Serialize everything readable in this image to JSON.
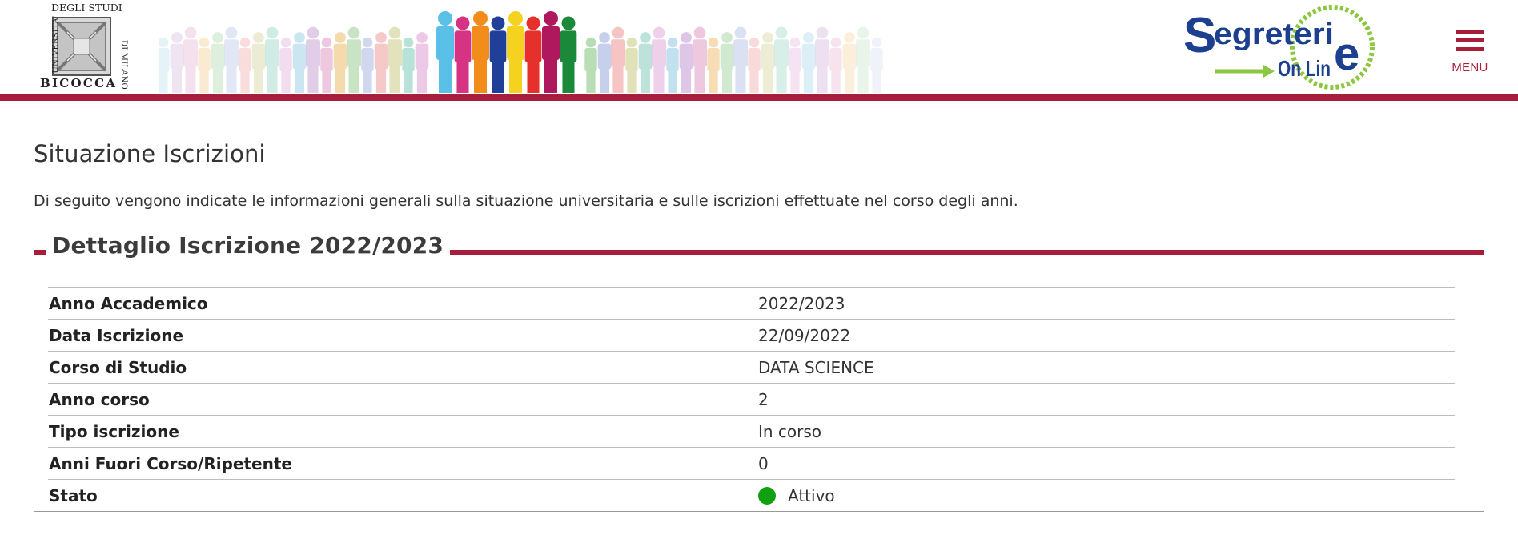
{
  "header": {
    "university_logo": {
      "top_text": "DEGLI STUDI",
      "left_text": "UNIVERSITA'",
      "right_text": "DI MILANO",
      "bottom_text": "BICOCCA"
    },
    "brand_logo": {
      "word_top": "egreteri",
      "word_bottom": "On Lin",
      "initial": "S",
      "final": "e",
      "arrow_color": "#8dc63f",
      "text_color": "#1d3f8f"
    },
    "menu_label": "MENU",
    "accent_color": "#a71e3b"
  },
  "main": {
    "title": "Situazione Iscrizioni",
    "intro": "Di seguito vengono indicate le informazioni generali sulla situazione universitaria e sulle iscrizioni effettuate nel corso degli anni.",
    "section": {
      "legend": "Dettaglio Iscrizione 2022/2023",
      "rows": [
        {
          "label": "Anno Accademico",
          "value": "2022/2023"
        },
        {
          "label": "Data Iscrizione",
          "value": "22/09/2022"
        },
        {
          "label": "Corso di Studio",
          "value": "DATA SCIENCE"
        },
        {
          "label": "Anno corso",
          "value": "2"
        },
        {
          "label": "Tipo iscrizione",
          "value": "In corso"
        },
        {
          "label": "Anni Fuori Corso/Ripetente",
          "value": "0"
        },
        {
          "label": "Stato",
          "value": "Attivo",
          "status_color": "#10a010"
        }
      ]
    }
  }
}
